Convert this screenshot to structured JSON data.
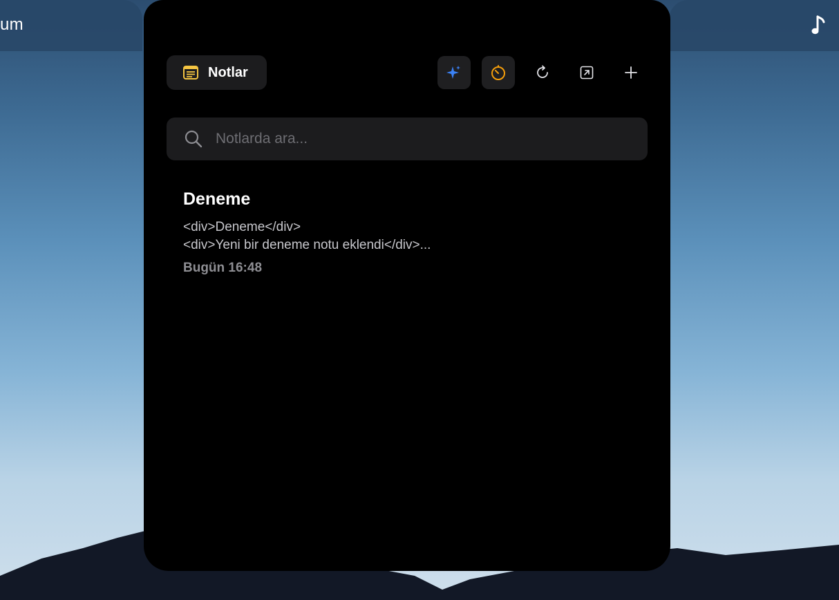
{
  "background_left": {
    "title_fragment": "um"
  },
  "background_right": {
    "icon": "music-note-icon"
  },
  "header": {
    "title": "Notlar",
    "title_icon": "notes-icon",
    "buttons": [
      {
        "name": "ai-sparkle-button",
        "icon": "sparkle-icon",
        "color": "#3b82f6"
      },
      {
        "name": "timer-button",
        "icon": "timer-icon",
        "color": "#f59e0b"
      },
      {
        "name": "refresh-button",
        "icon": "refresh-icon"
      },
      {
        "name": "open-external-button",
        "icon": "open-external-icon"
      },
      {
        "name": "add-note-button",
        "icon": "plus-icon"
      }
    ]
  },
  "search": {
    "placeholder": "Notlarda ara...",
    "value": ""
  },
  "notes": [
    {
      "title": "Deneme",
      "preview_line1": "<div>Deneme</div>",
      "preview_line2": "<div>Yeni bir deneme notu eklendi</div>...",
      "date": "Bugün 16:48"
    }
  ],
  "colors": {
    "panel_bg": "#000000",
    "chip_bg": "#1c1c1e",
    "accent_yellow": "#f5c542",
    "accent_blue": "#3b82f6",
    "accent_orange": "#f59e0b"
  }
}
